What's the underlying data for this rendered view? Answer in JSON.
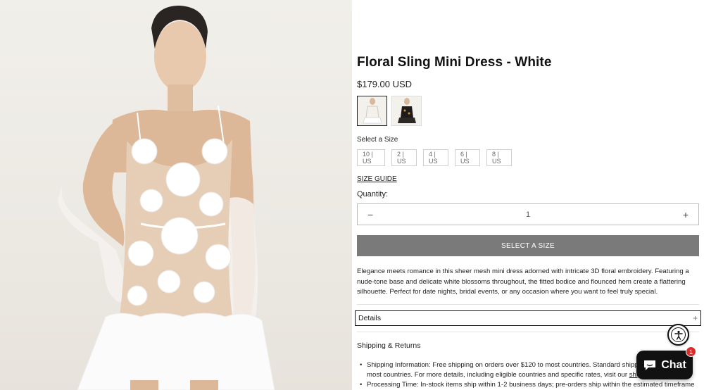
{
  "product": {
    "title": "Floral Sling Mini Dress - White",
    "price": "$179.00 USD",
    "variants": [
      {
        "name": "White",
        "selected": true
      },
      {
        "name": "Black",
        "selected": false
      }
    ]
  },
  "size_selector": {
    "label": "Select a Size",
    "options": [
      "10 | US",
      "2 | US",
      "4 | US",
      "6 | US",
      "8 | US"
    ],
    "guide_link": "SIZE GUIDE"
  },
  "quantity": {
    "label": "Quantity:",
    "value": "1",
    "decrement": "−",
    "increment": "+"
  },
  "cta": {
    "label": "SELECT A SIZE"
  },
  "description": "Elegance meets romance in this sheer mesh mini dress adorned with intricate 3D floral embroidery. Featuring a nude-tone base and delicate white blossoms throughout, the fitted bodice and flounced hem create a flattering silhouette. Perfect for date nights, bridal events, or any occasion where you want to feel truly special.",
  "accordions": {
    "details": {
      "label": "Details",
      "icon": "+"
    },
    "shipping": {
      "label": "Shipping & Returns"
    }
  },
  "shipping_items": [
    {
      "text": "Shipping Information: Free shipping on orders over $120 to most countries. Standard shipping rates apply for most countries. For more details, including eligible countries and specific rates, visit our ",
      "link": "shipping policy"
    },
    {
      "text": "Processing Time: In-stock items ship within 1-2 business days; pre-orders ship within the estimated timeframe",
      "link": ""
    }
  ],
  "chat_widget": {
    "label": "Chat",
    "badge": "1"
  },
  "colors": {
    "cta_bg": "#7a7a7a",
    "chat_bg": "#111111",
    "badge": "#d92c2c"
  }
}
